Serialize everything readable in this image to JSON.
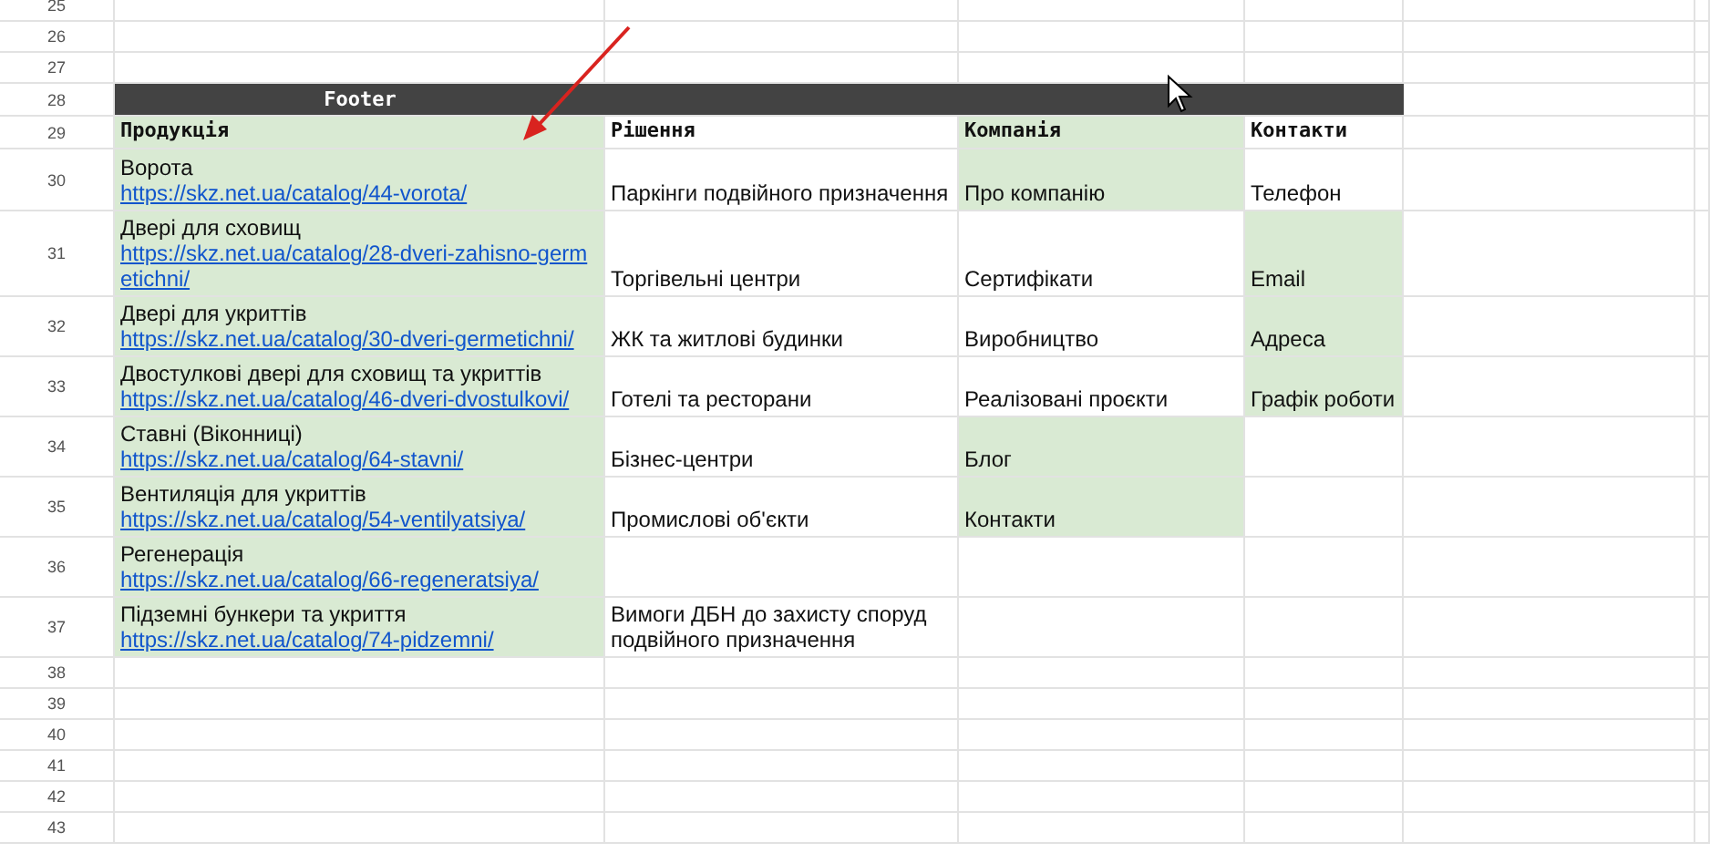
{
  "sheet": {
    "rows_before": [
      "25",
      "26",
      "27"
    ],
    "section_row": {
      "number": "28",
      "title": "Footer"
    },
    "header_row": {
      "number": "29",
      "cells": [
        {
          "text": "Продукція",
          "highlighted": true
        },
        {
          "text": "Рішення",
          "highlighted": false
        },
        {
          "text": "Компанія",
          "highlighted": true
        },
        {
          "text": "Контакти",
          "highlighted": false
        }
      ]
    },
    "rows": [
      {
        "number": "30",
        "cells": [
          {
            "text": "Ворота",
            "link": "https://skz.net.ua/catalog/44-vorota/",
            "highlighted": true
          },
          {
            "text": "Паркінги подвійного призначення",
            "highlighted": false
          },
          {
            "text": "Про компанію",
            "highlighted": true
          },
          {
            "text": "Телефон",
            "highlighted": false
          }
        ]
      },
      {
        "number": "31",
        "cells": [
          {
            "text": "Двері для сховищ",
            "link": "https://skz.net.ua/catalog/28-dveri-zahisno-germetichni/",
            "highlighted": true
          },
          {
            "text": "Торгівельні центри",
            "highlighted": false
          },
          {
            "text": "Сертифікати",
            "highlighted": false
          },
          {
            "text": "Email",
            "highlighted": true
          }
        ]
      },
      {
        "number": "32",
        "cells": [
          {
            "text": "Двері для укриттів",
            "link": "https://skz.net.ua/catalog/30-dveri-germetichni/",
            "highlighted": true
          },
          {
            "text": "ЖК та житлові будинки",
            "highlighted": false
          },
          {
            "text": "Виробництво",
            "highlighted": false
          },
          {
            "text": "Адреса",
            "highlighted": true
          }
        ]
      },
      {
        "number": "33",
        "cells": [
          {
            "text": "Двостулкові двері для сховищ та укриттів",
            "link": "https://skz.net.ua/catalog/46-dveri-dvostulkovi/",
            "highlighted": true
          },
          {
            "text": "Готелі та ресторани",
            "highlighted": false
          },
          {
            "text": "Реалізовані проєкти",
            "highlighted": false
          },
          {
            "text": "Графік роботи",
            "highlighted": true
          }
        ]
      },
      {
        "number": "34",
        "cells": [
          {
            "text": "Ставні (Віконниці)",
            "link": "https://skz.net.ua/catalog/64-stavni/",
            "highlighted": true
          },
          {
            "text": "Бізнес-центри",
            "highlighted": false
          },
          {
            "text": "Блог",
            "highlighted": true
          },
          {
            "text": "",
            "highlighted": false
          }
        ]
      },
      {
        "number": "35",
        "cells": [
          {
            "text": "Вентиляція для укриттів",
            "link": "https://skz.net.ua/catalog/54-ventilyatsiya/",
            "highlighted": true
          },
          {
            "text": "Промислові об'єкти",
            "highlighted": false
          },
          {
            "text": "Контакти",
            "highlighted": true
          },
          {
            "text": "",
            "highlighted": false
          }
        ]
      },
      {
        "number": "36",
        "cells": [
          {
            "text": "Регенерація",
            "link": "https://skz.net.ua/catalog/66-regeneratsiya/",
            "highlighted": true
          },
          {
            "text": "",
            "highlighted": false
          },
          {
            "text": "",
            "highlighted": false
          },
          {
            "text": "",
            "highlighted": false
          }
        ]
      },
      {
        "number": "37",
        "cells": [
          {
            "text": "Підземні бункери та укриття",
            "link": "https://skz.net.ua/catalog/74-pidzemni/",
            "highlighted": true
          },
          {
            "text": "Вимоги ДБН до захисту споруд подвійного призначення",
            "highlighted": false
          },
          {
            "text": "",
            "highlighted": false
          },
          {
            "text": "",
            "highlighted": false
          }
        ]
      }
    ],
    "rows_after": [
      "38",
      "39",
      "40",
      "41",
      "42",
      "43"
    ]
  }
}
